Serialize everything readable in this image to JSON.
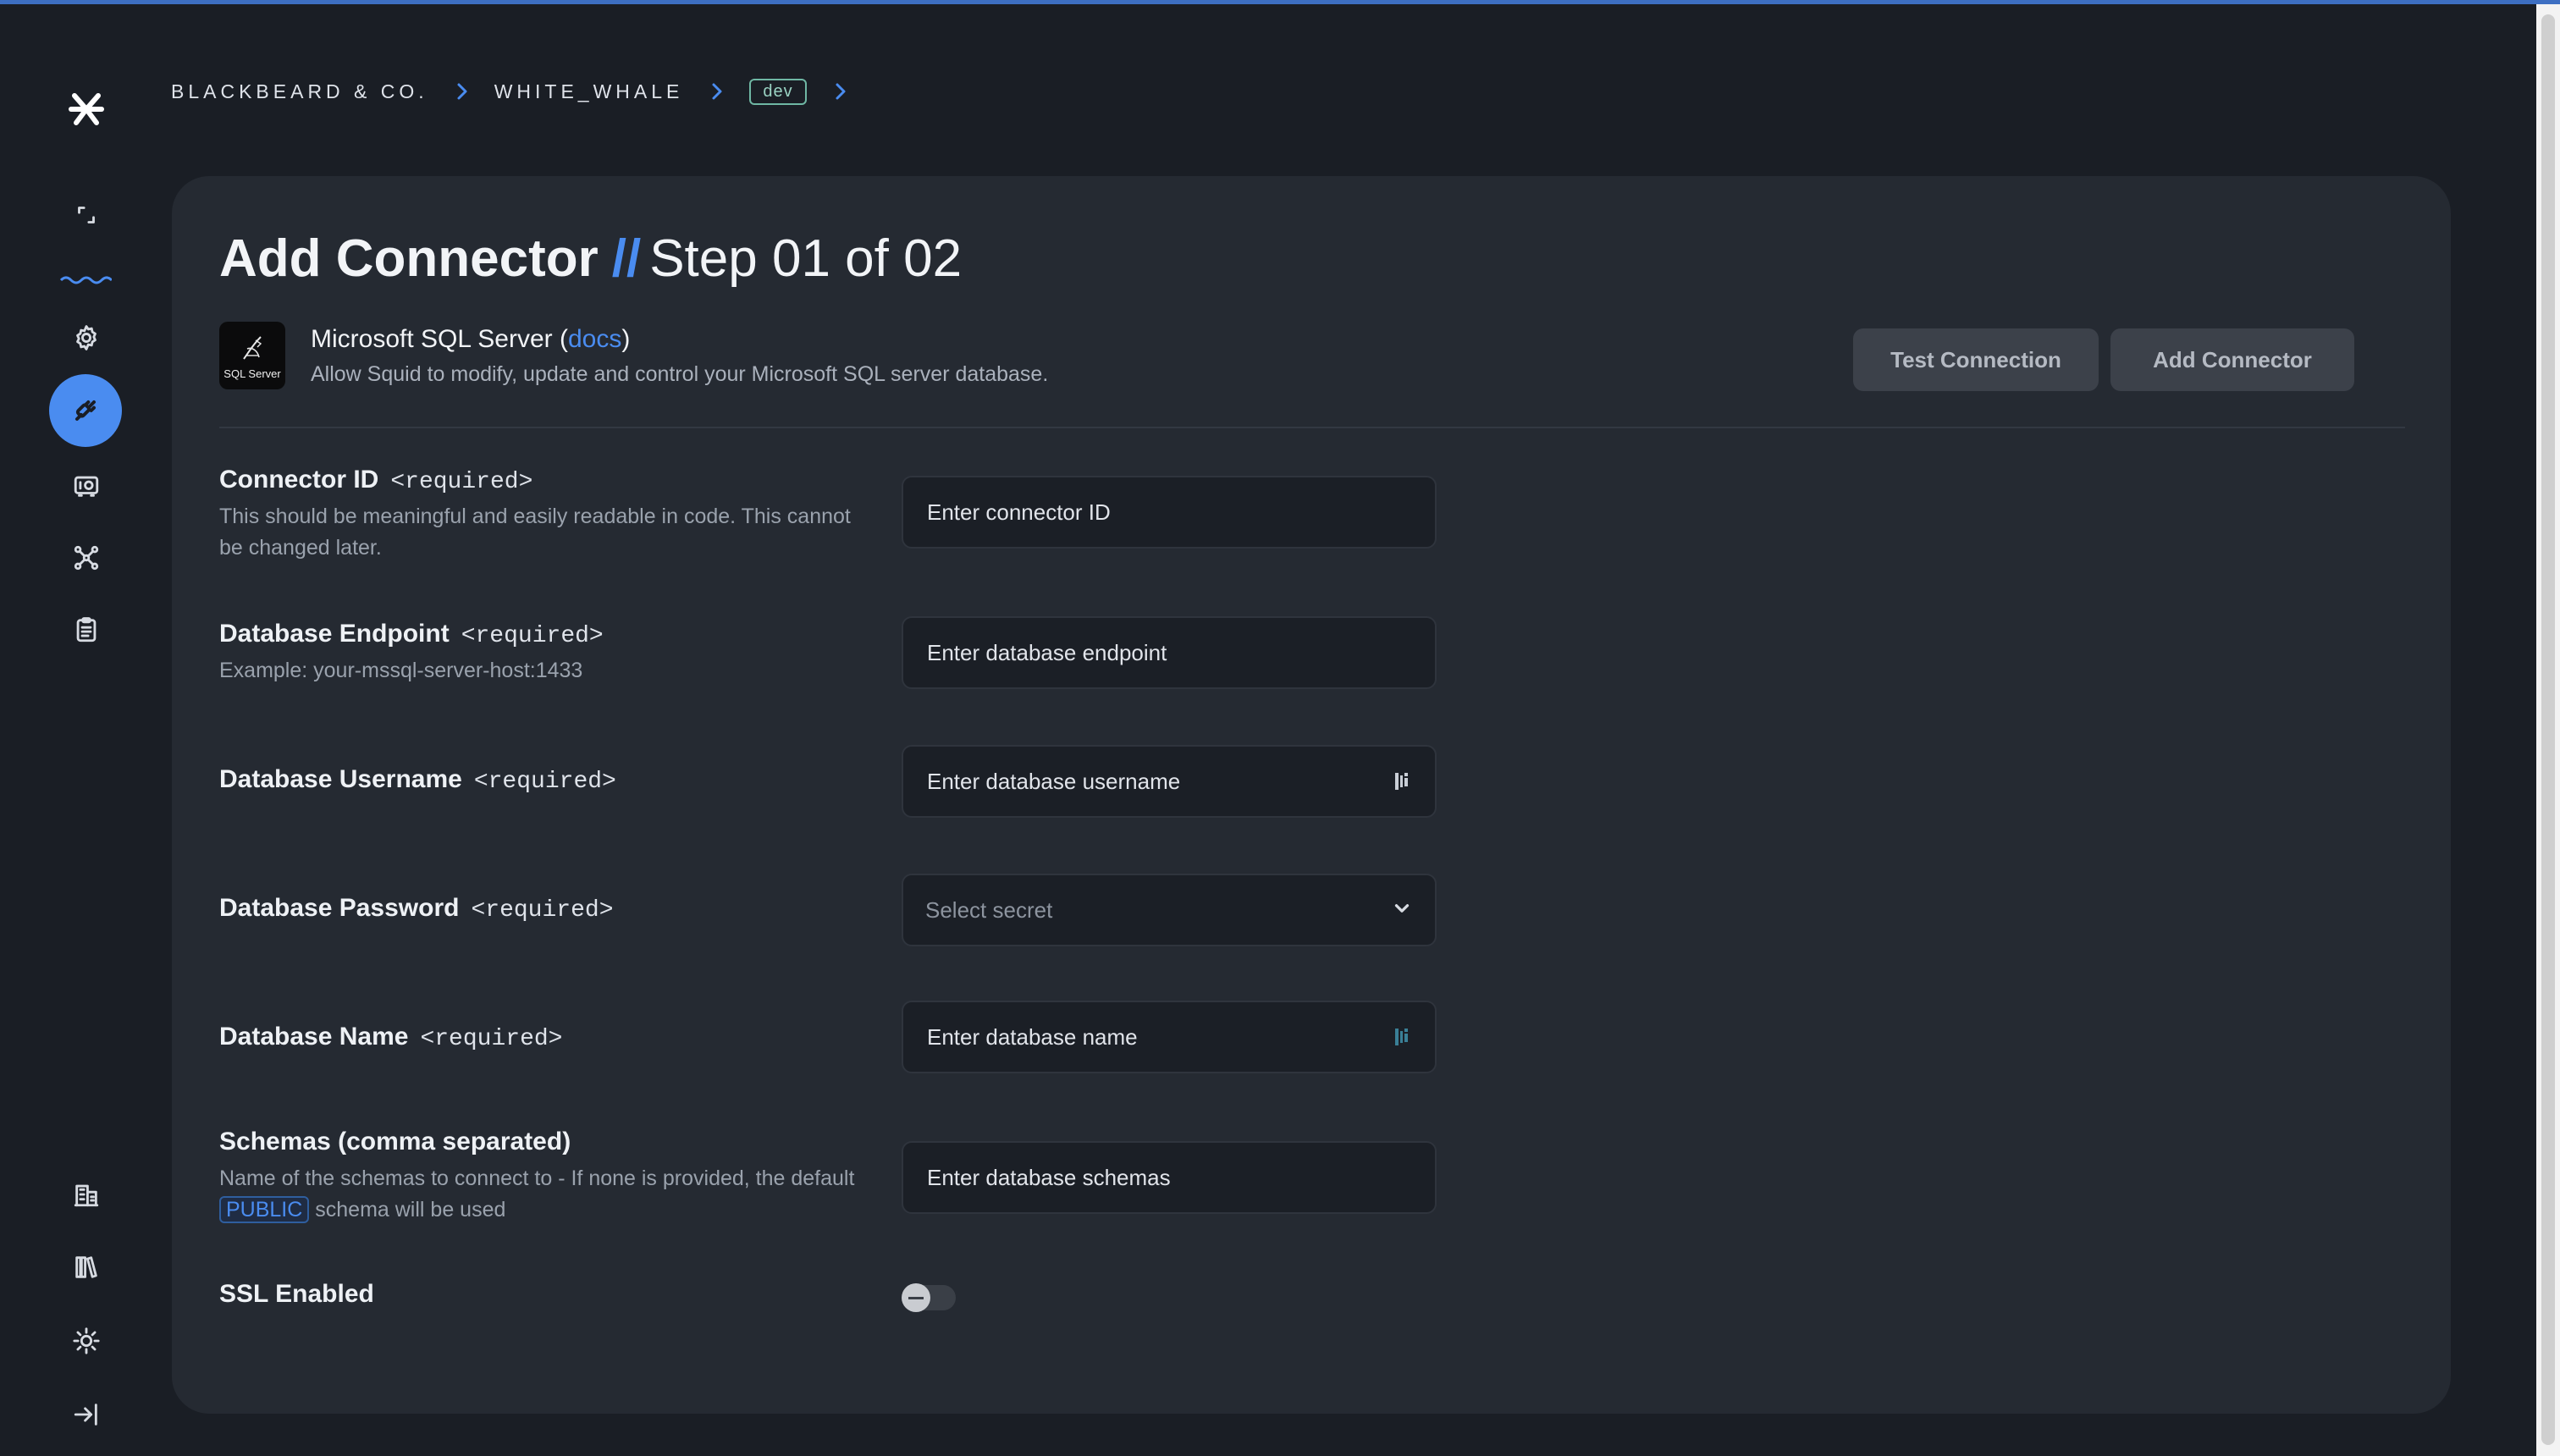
{
  "breadcrumb": {
    "org": "BLACKBEARD & CO.",
    "project": "WHITE_WHALE",
    "env": "dev"
  },
  "page": {
    "title_main": "Add Connector",
    "title_sep": "//",
    "title_step": "Step 01 of 02"
  },
  "connector": {
    "logo_text": "SQL Server",
    "name_prefix": "Microsoft SQL Server (",
    "docs_label": "docs",
    "name_suffix": ")",
    "description": "Allow Squid to modify, update and control your Microsoft SQL server database."
  },
  "actions": {
    "test_label": "Test Connection",
    "add_label": "Add Connector"
  },
  "form": {
    "connector_id": {
      "label": "Connector ID",
      "req": "<required>",
      "help": "This should be meaningful and easily readable in code. This cannot be changed later.",
      "placeholder": "Enter connector ID"
    },
    "endpoint": {
      "label": "Database Endpoint",
      "req": "<required>",
      "help": "Example: your-mssql-server-host:1433",
      "placeholder": "Enter database endpoint"
    },
    "username": {
      "label": "Database Username",
      "req": "<required>",
      "placeholder": "Enter database username"
    },
    "password": {
      "label": "Database Password",
      "req": "<required>",
      "placeholder": "Select secret"
    },
    "dbname": {
      "label": "Database Name",
      "req": "<required>",
      "placeholder": "Enter database name"
    },
    "schemas": {
      "label": "Schemas (comma separated)",
      "help_pre": "Name of the schemas to connect to - If none is provided, the default",
      "help_chip": "PUBLIC",
      "help_post": "schema will be used",
      "placeholder": "Enter database schemas"
    },
    "ssl": {
      "label": "SSL Enabled",
      "enabled": false
    }
  },
  "colors": {
    "accent": "#4a8cf0",
    "background": "#1a1e25",
    "card": "#252a32"
  }
}
